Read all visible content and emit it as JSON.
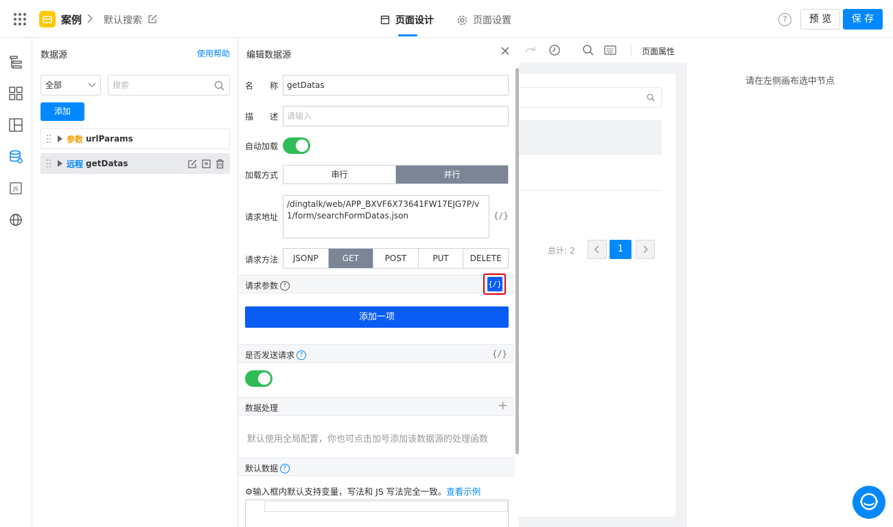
{
  "header": {
    "app_name": "案例",
    "page_name": "默认搜索",
    "tabs": [
      {
        "label": "页面设计",
        "active": true
      },
      {
        "label": "页面设置",
        "active": false
      }
    ],
    "help": "?",
    "preview_label": "预 览",
    "save_label": "保 存"
  },
  "rail": {
    "icons": [
      "outline-tree-icon",
      "components-icon",
      "layout-icon",
      "datasource-icon",
      "js-icon",
      "globe-icon"
    ],
    "js_label": "JS"
  },
  "datasource_panel": {
    "title": "数据源",
    "help_link": "使用帮助",
    "filter_value": "全部",
    "search_placeholder": "搜索",
    "add_label": "添加",
    "items": [
      {
        "tag": "参数",
        "name": "urlParams",
        "selected": false
      },
      {
        "tag": "远程",
        "name": "getDatas",
        "selected": true
      }
    ]
  },
  "edit_panel": {
    "title": "编辑数据源",
    "name_label": "名　　称",
    "name_value": "getDatas",
    "desc_label": "描　　述",
    "desc_placeholder": "请输入",
    "autoload_label": "自动加载",
    "autoload_on": true,
    "load_mode_label": "加载方式",
    "load_modes": [
      "串行",
      "并行"
    ],
    "load_mode_selected": "并行",
    "url_label": "请求地址",
    "url_value": "/dingtalk/web/APP_BXVF6X73641FW17EJG7P/v1/form/searchFormDatas.json",
    "code_toggle": "{/}",
    "method_label": "请求方法",
    "methods": [
      "JSONP",
      "GET",
      "POST",
      "PUT",
      "DELETE"
    ],
    "method_selected": "GET",
    "params_label": "请求参数",
    "add_item_label": "添加一项",
    "send_label": "是否发送请求",
    "send_on": true,
    "process_label": "数据处理",
    "process_plus": "+",
    "process_hint": "默认使用全局配置，你也可点击加号添加该数据源的处理函数",
    "default_label": "默认数据",
    "default_hint": "⚙输入框内默认支持变量，写法和 JS 写法完全一致。",
    "example_link": "查看示例"
  },
  "canvas": {
    "toolbar_label": "页面属性",
    "total_text": "总计: 2",
    "current_page": "1"
  },
  "props": {
    "empty_text": "请在左侧画布选中节点"
  },
  "colors": {
    "accent": "#0089ff",
    "toggle_on": "#2fbc56",
    "segment_on": "#7b8596",
    "add_item": "#0a5cf5",
    "highlight": "#e2001a"
  }
}
